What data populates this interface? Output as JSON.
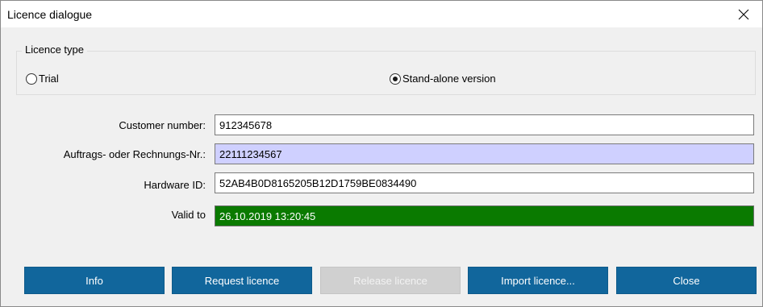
{
  "window": {
    "title": "Licence dialogue"
  },
  "licence_type": {
    "legend": "Licence type",
    "options": [
      {
        "label": "Trial",
        "selected": false
      },
      {
        "label": "Stand-alone version",
        "selected": true
      }
    ]
  },
  "fields": {
    "customer_number": {
      "label": "Customer number:",
      "value": "912345678"
    },
    "order_number": {
      "label": "Auftrags- oder Rechnungs-Nr.:",
      "value": "22111234567"
    },
    "hardware_id": {
      "label": "Hardware ID:",
      "value": "52AB4B0D8165205B12D1759BE0834490"
    },
    "valid_to": {
      "label": "Valid to",
      "value": "26.10.2019 13:20:45"
    }
  },
  "buttons": {
    "info": "Info",
    "request": "Request licence",
    "release": "Release licence",
    "import": "Import licence...",
    "close": "Close"
  },
  "colors": {
    "button": "#11669c",
    "valid_field": "#0a7a00",
    "highlight_field": "#cfd0ff"
  }
}
